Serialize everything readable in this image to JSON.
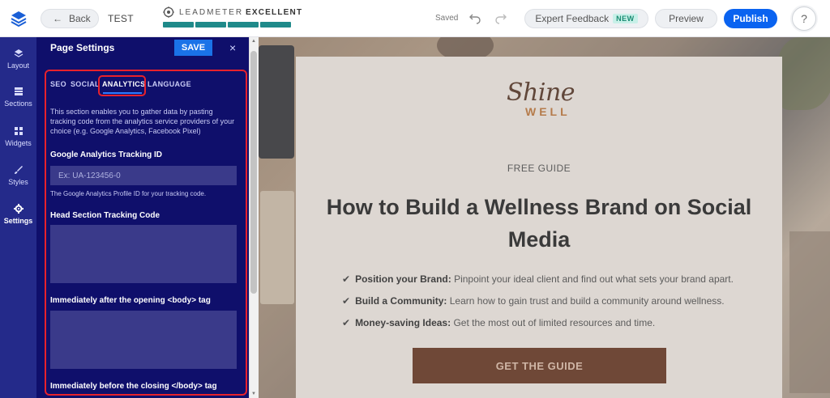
{
  "topbar": {
    "back_label": "Back",
    "page_name": "TEST",
    "leadmeter_label": "LEADMETER",
    "leadmeter_value": "EXCELLENT",
    "leadmeter_level": 4,
    "leadmeter_max": 4,
    "saved_label": "Saved",
    "expert_label": "Expert Feedback",
    "new_badge": "NEW",
    "preview_label": "Preview",
    "publish_label": "Publish",
    "help_label": "?"
  },
  "rail": {
    "items": [
      {
        "label": "Layout",
        "icon": "layers-icon"
      },
      {
        "label": "Sections",
        "icon": "sections-icon"
      },
      {
        "label": "Widgets",
        "icon": "widgets-icon"
      },
      {
        "label": "Styles",
        "icon": "brush-icon"
      },
      {
        "label": "Settings",
        "icon": "gear-icon"
      }
    ]
  },
  "panel": {
    "title": "Page Settings",
    "save_label": "SAVE",
    "close_label": "×",
    "tabs": [
      {
        "label": "SEO"
      },
      {
        "label": "SOCIAL"
      },
      {
        "label": "ANALYTICS"
      },
      {
        "label": "LANGUAGE"
      }
    ],
    "active_tab": "ANALYTICS",
    "intro": "This section enables you to gather data by pasting tracking code from the analytics service providers of your choice (e.g. Google Analytics, Facebook Pixel)",
    "ga_label": "Google Analytics Tracking ID",
    "ga_placeholder": "Ex: UA-123456-0",
    "ga_help": "The Google Analytics Profile ID for your tracking code.",
    "head_label": "Head Section Tracking Code",
    "body_open_label": "Immediately after the opening <body> tag",
    "body_close_label": "Immediately before the closing </body> tag"
  },
  "canvas": {
    "brand_top": "Shine",
    "brand_bottom": "WELL",
    "eyebrow": "FREE GUIDE",
    "headline": "How to Build a Wellness Brand on Social Media",
    "bullets": [
      {
        "bold": "Position your Brand:",
        "text": "Pinpoint your ideal client and find out what sets your brand apart."
      },
      {
        "bold": "Build a Community:",
        "text": "Learn how to gain trust and build a community around wellness."
      },
      {
        "bold": "Money-saving Ideas:",
        "text": "Get the most out of limited resources and time."
      }
    ],
    "cta": "GET THE GUIDE"
  }
}
